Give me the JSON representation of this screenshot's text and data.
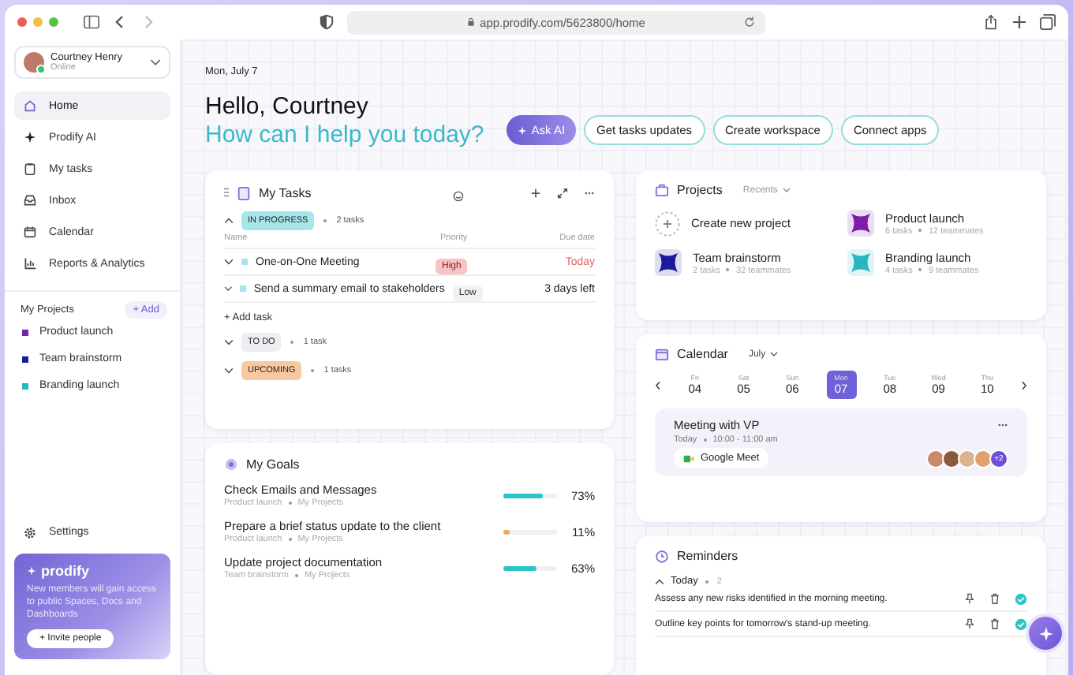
{
  "browser": {
    "url": "app.prodify.com/5623800/home"
  },
  "user": {
    "name": "Courtney Henry",
    "status": "Online"
  },
  "nav": [
    {
      "label": "Home",
      "selected": true
    },
    {
      "label": "Prodify AI",
      "selected": false
    },
    {
      "label": "My tasks",
      "selected": false
    },
    {
      "label": "Inbox",
      "selected": false
    },
    {
      "label": "Calendar",
      "selected": false
    },
    {
      "label": "Reports & Analytics",
      "selected": false
    }
  ],
  "my_projects": {
    "title": "My Projects",
    "add": "+ Add",
    "items": [
      {
        "name": "Product launch",
        "color": "#7a1fa8"
      },
      {
        "name": "Team brainstorm",
        "color": "#1a1a9e"
      },
      {
        "name": "Branding launch",
        "color": "#29b6c0"
      }
    ]
  },
  "settings": "Settings",
  "promo": {
    "brand": "prodify",
    "text": "New members will gain access to public Spaces, Docs and Dashboards",
    "button": "+ Invite people"
  },
  "header": {
    "date": "Mon, July 7",
    "greeting": "Hello, Courtney",
    "prompt": "How can I help you today?",
    "actions": [
      {
        "label": "Ask AI",
        "kind": "primary"
      },
      {
        "label": "Get tasks updates",
        "kind": "outline"
      },
      {
        "label": "Create workspace",
        "kind": "outline"
      },
      {
        "label": "Connect apps",
        "kind": "outline"
      }
    ]
  },
  "tasks": {
    "title": "My Tasks",
    "columns": [
      "Name",
      "Priority",
      "Due date"
    ],
    "add_task": "+ Add task",
    "groups": [
      {
        "label": "IN PROGRESS",
        "count": "2 tasks",
        "color": "#a6e6ea",
        "expanded": true,
        "tasks": [
          {
            "name": "One-on-One Meeting",
            "priority": "High",
            "kind": "high",
            "due": "Today",
            "urgent": true
          },
          {
            "name": "Send a summary email to stakeholders",
            "priority": "Low",
            "kind": "low",
            "due": "3 days left",
            "urgent": false
          }
        ]
      },
      {
        "label": "TO DO",
        "count": "1 task",
        "color": "#eeeef2",
        "expanded": false
      },
      {
        "label": "UPCOMING",
        "count": "1 tasks",
        "color": "#f7c9a0",
        "expanded": false
      }
    ]
  },
  "goals": {
    "title": "My Goals",
    "items": [
      {
        "name": "Check Emails and Messages",
        "project": "Product launch",
        "space": "My Projects",
        "level": 0.73,
        "reading": "73%",
        "color": "#2cc4c4"
      },
      {
        "name": "Prepare a brief status update to the client",
        "project": "Product launch",
        "space": "My Projects",
        "level": 0.11,
        "reading": "11%",
        "color": "#f0a860"
      },
      {
        "name": "Update project documentation",
        "project": "Team brainstorm",
        "space": "My Projects",
        "level": 0.63,
        "reading": "63%",
        "color": "#2cc4c4"
      }
    ]
  },
  "projects": {
    "title": "Projects",
    "filter": "Recents",
    "items": [
      {
        "kind": "create",
        "name": "Create new project"
      },
      {
        "kind": "project",
        "name": "Product launch",
        "tasks": "6 tasks",
        "team": "12 teammates",
        "color": "#7a1fa8"
      },
      {
        "kind": "project",
        "name": "Team brainstorm",
        "tasks": "2 tasks",
        "team": "32 teammates",
        "color": "#1a1a9e"
      },
      {
        "kind": "project",
        "name": "Branding launch",
        "tasks": "4 tasks",
        "team": "9 teammates",
        "color": "#29b6c0"
      }
    ]
  },
  "calendar": {
    "title": "Calendar",
    "month": "July",
    "days": [
      {
        "weekday": "Fri",
        "date": "04",
        "selected": false
      },
      {
        "weekday": "Sat",
        "date": "05",
        "selected": false
      },
      {
        "weekday": "Sun",
        "date": "06",
        "selected": false
      },
      {
        "weekday": "Mon",
        "date": "07",
        "selected": true
      },
      {
        "weekday": "Tue",
        "date": "08",
        "selected": false
      },
      {
        "weekday": "Wed",
        "date": "09",
        "selected": false
      },
      {
        "weekday": "Thu",
        "date": "10",
        "selected": false
      }
    ],
    "event": {
      "title": "Meeting with VP",
      "day": "Today",
      "time": "10:00 - 11:00 am",
      "link": "Google Meet",
      "more": "+2"
    }
  },
  "reminders": {
    "title": "Reminders",
    "group": "Today",
    "count": "2",
    "expanded": true,
    "items": [
      {
        "text": "Assess any new risks identified in the morning meeting.",
        "done": true
      },
      {
        "text": "Outline key points for tomorrow's stand-up meeting.",
        "done": true
      }
    ]
  }
}
